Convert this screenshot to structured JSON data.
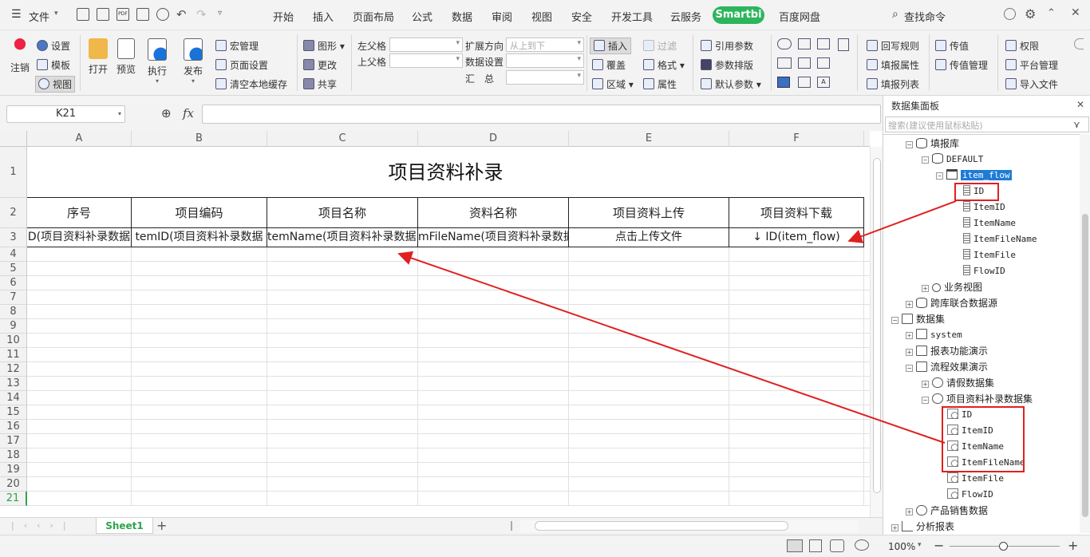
{
  "menubar": {
    "file_label": "文件",
    "tabs": [
      "开始",
      "插入",
      "页面布局",
      "公式",
      "数据",
      "审阅",
      "视图",
      "安全",
      "开发工具",
      "云服务"
    ],
    "smartbi_tab": "Smartbi",
    "extra_tab": "百度网盘",
    "search_label": "查找命令"
  },
  "ribbon": {
    "logout": "注销",
    "settings": "设置",
    "template": "模板",
    "view": "视图",
    "open": "打开",
    "preview": "预览",
    "execute": "执行",
    "publish": "发布",
    "macro": "宏管理",
    "page_setup": "页面设置",
    "clear_cache": "清空本地缓存",
    "chart": "图形",
    "change": "更改",
    "share": "共享",
    "left_parent": "左父格",
    "top_parent": "上父格",
    "expand_dir": "扩展方向",
    "expand_dir_value": "从上到下",
    "data_settings": "数据设置",
    "summary": "汇　总",
    "insert": "插入",
    "overwrite": "覆盖",
    "region": "区域",
    "filter": "过滤",
    "format": "格式",
    "property": "属性",
    "ref_param": "引用参数",
    "param_layout": "参数排版",
    "default_param": "默认参数",
    "writeback": "回写规则",
    "fill_property": "填报属性",
    "fill_list": "填报列表",
    "pass_value": "传值",
    "pass_value_mgr": "传值管理",
    "permission": "权限",
    "platform_mgr": "平台管理",
    "import_file": "导入文件"
  },
  "formula": {
    "cell_ref": "K21",
    "fx": "fx"
  },
  "sheet": {
    "columns": [
      "A",
      "B",
      "C",
      "D",
      "E",
      "F"
    ],
    "rows": [
      "1",
      "2",
      "3",
      "4",
      "5",
      "6",
      "7",
      "8",
      "9",
      "10",
      "11",
      "12",
      "13",
      "14",
      "15",
      "16",
      "17",
      "18",
      "19",
      "20",
      "21"
    ],
    "title": "项目资料补录",
    "headers": [
      "序号",
      "项目编码",
      "项目名称",
      "资料名称",
      "项目资料上传",
      "项目资料下载"
    ],
    "row3": [
      "D(项目资料补录数据",
      "temID(项目资料补录数据",
      "temName(项目资料补录数据",
      "mFileName(项目资料补录数据",
      "点击上传文件",
      "↓ ID(item_flow)"
    ]
  },
  "sheet_tabs": {
    "active": "Sheet1",
    "add": "+"
  },
  "status": {
    "zoom": "100%"
  },
  "panel": {
    "title": "数据集面板",
    "search_placeholder": "搜索(建议使用鼠标粘贴)",
    "tree": [
      {
        "label": "填报库"
      },
      {
        "label": "DEFAULT"
      },
      {
        "label": "item_flow"
      },
      {
        "label": "ID"
      },
      {
        "label": "ItemID"
      },
      {
        "label": "ItemName"
      },
      {
        "label": "ItemFileName"
      },
      {
        "label": "ItemFile"
      },
      {
        "label": "FlowID"
      },
      {
        "label": "业务视图"
      },
      {
        "label": "跨库联合数据源"
      },
      {
        "label": "数据集"
      },
      {
        "label": "system"
      },
      {
        "label": "报表功能演示"
      },
      {
        "label": "流程效果演示"
      },
      {
        "label": "请假数据集"
      },
      {
        "label": "项目资料补录数据集"
      },
      {
        "label": "ID"
      },
      {
        "label": "ItemID"
      },
      {
        "label": "ItemName"
      },
      {
        "label": "ItemFileName"
      },
      {
        "label": "ItemFile"
      },
      {
        "label": "FlowID"
      },
      {
        "label": "产品销售数据"
      },
      {
        "label": "分析报表"
      }
    ]
  },
  "colors": {
    "accent_green": "#2db55d",
    "selection_blue": "#1e7bd6",
    "annotation_red": "#e02020"
  }
}
